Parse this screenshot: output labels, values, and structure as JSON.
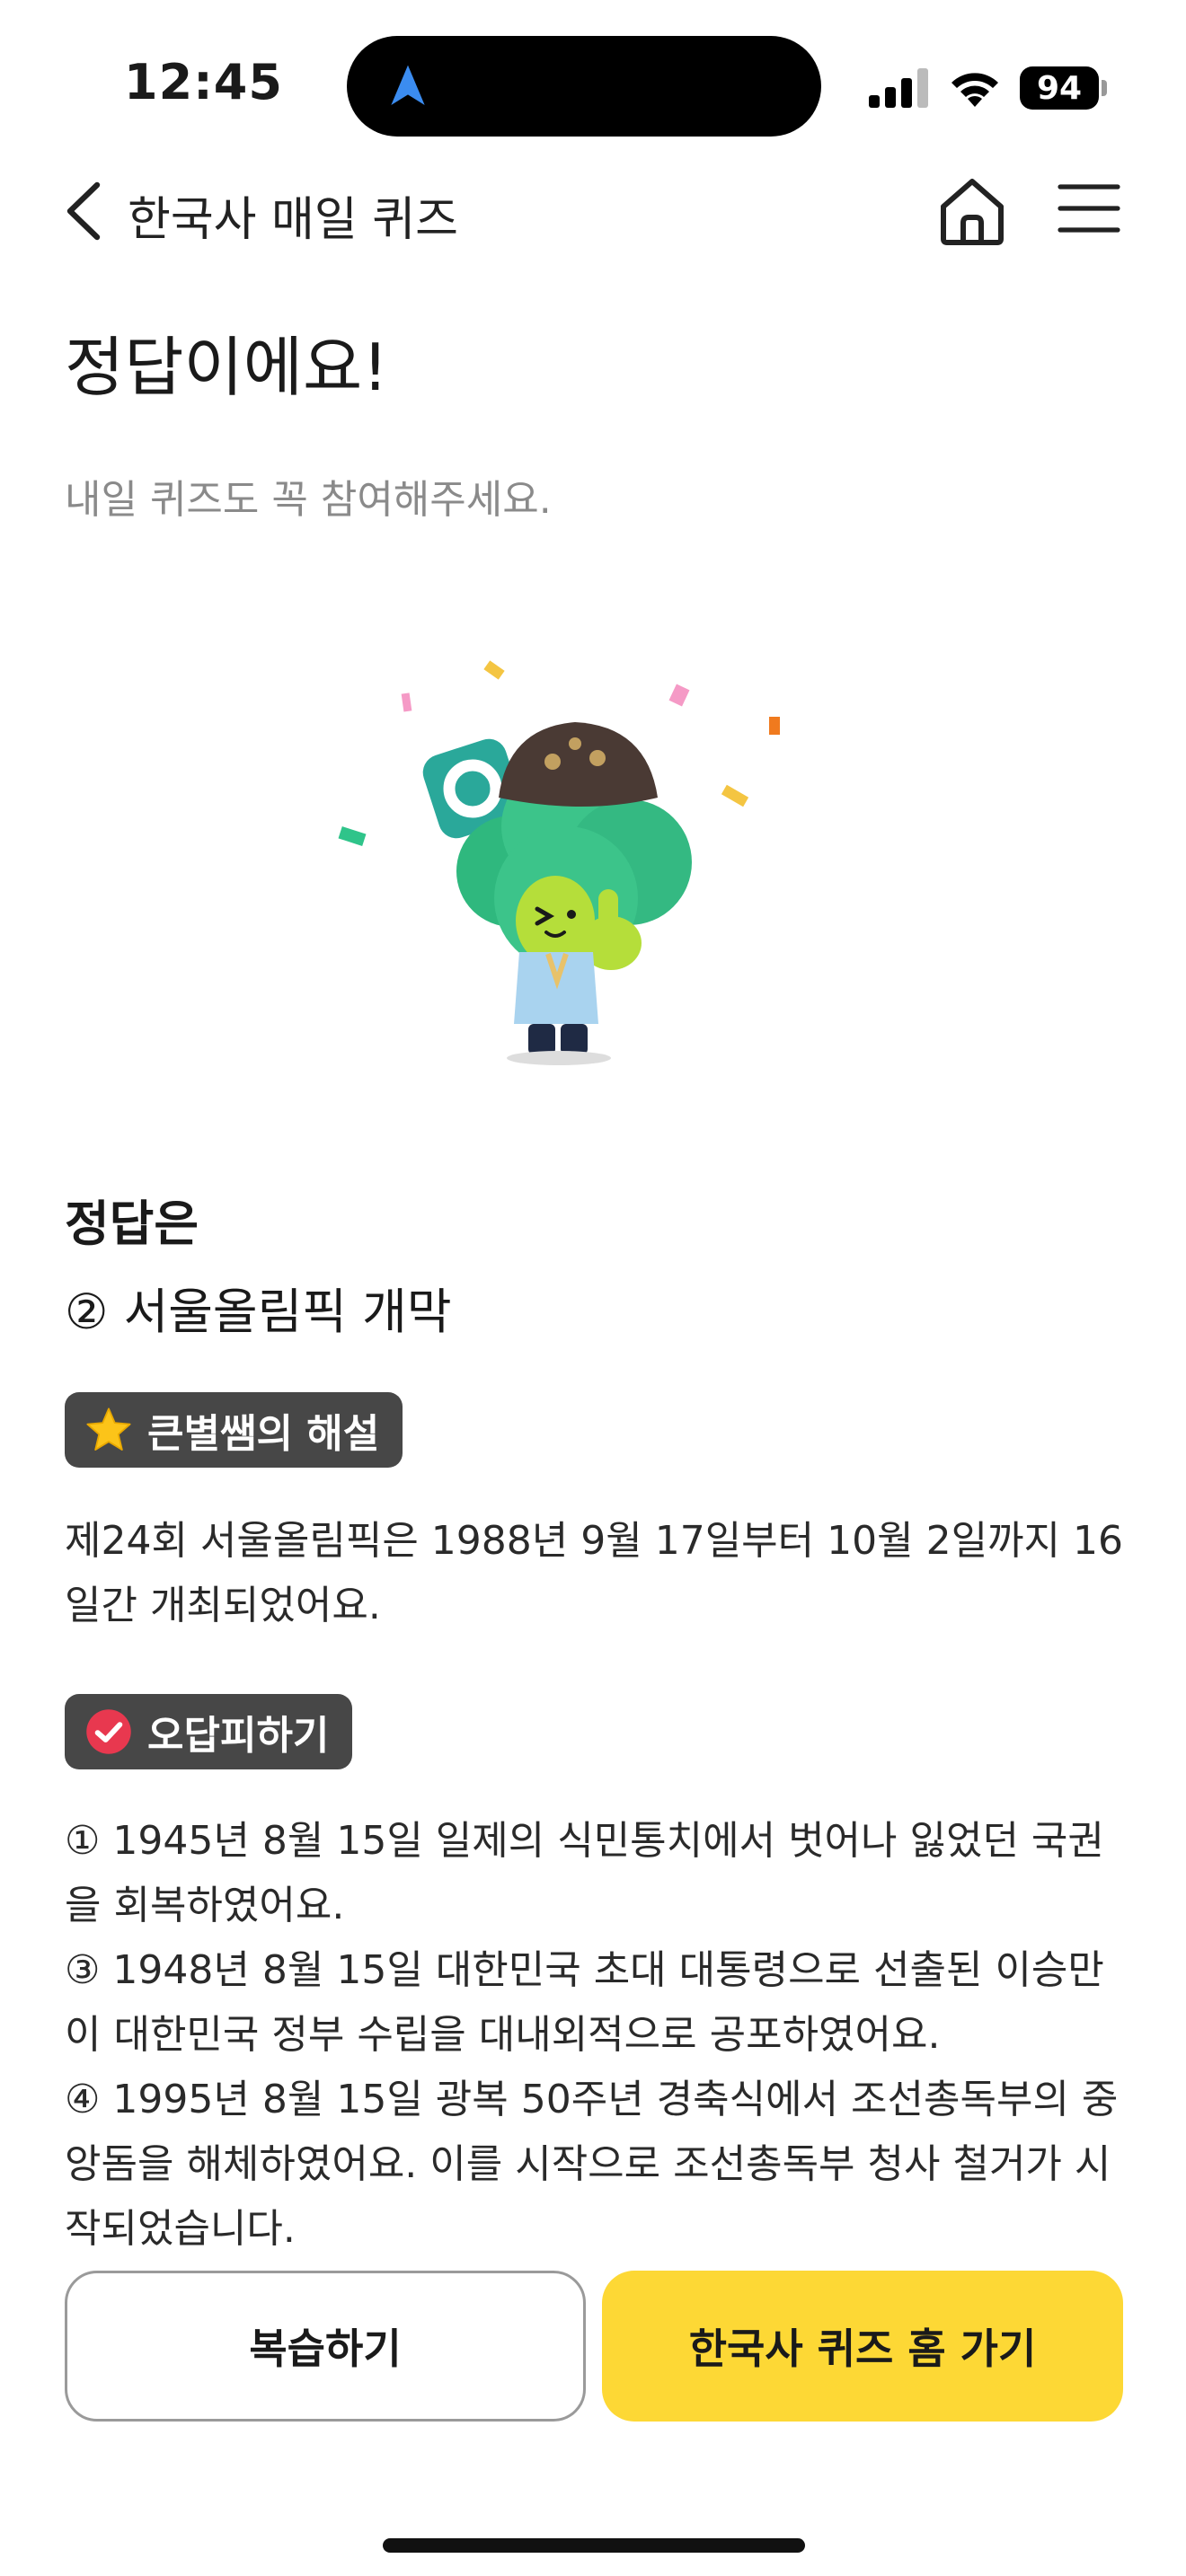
{
  "status_bar": {
    "time": "12:45",
    "battery": "94",
    "icons": [
      "location-arrow-icon",
      "cellular-signal-icon",
      "wifi-icon",
      "battery-icon"
    ]
  },
  "nav": {
    "title": "한국사 매일 퀴즈",
    "icons": [
      "chevron-left-icon",
      "home-icon",
      "hamburger-menu-icon"
    ]
  },
  "result": {
    "headline": "정답이에요!",
    "subtext": "내일 퀴즈도 꼭 참여해주세요."
  },
  "answer": {
    "label": "정답은",
    "value": "② 서울올림픽 개막"
  },
  "explanation": {
    "tag": "큰별쌤의 해설",
    "tag_icon": "star-icon",
    "text": "제24회 서울올림픽은 1988년 9월 17일부터 10월 2일까지 16일간 개최되었어요."
  },
  "wrong_answers": {
    "tag": "오답피하기",
    "tag_icon": "checkmark-circle-icon",
    "items": [
      "① 1945년 8월 15일 일제의 식민통치에서 벗어나 잃었던 국권을 회복하였어요.",
      "③ 1948년 8월 15일 대한민국 초대 대통령으로 선출된 이승만이 대한민국 정부 수립을 대내외적으로 공포하였어요.",
      "④ 1995년 8월 15일 광복 50주년 경축식에서 조선총독부의 중앙돔을 해체하였어요. 이를 시작으로 조선총독부 청사 철거가 시작되었습니다."
    ]
  },
  "buttons": {
    "review": "복습하기",
    "go_home": "한국사 퀴즈 홈 가기"
  },
  "colors": {
    "accent_yellow": "#fdd835",
    "tag_bg": "#474747",
    "mascot_green": "#3cc48a"
  }
}
